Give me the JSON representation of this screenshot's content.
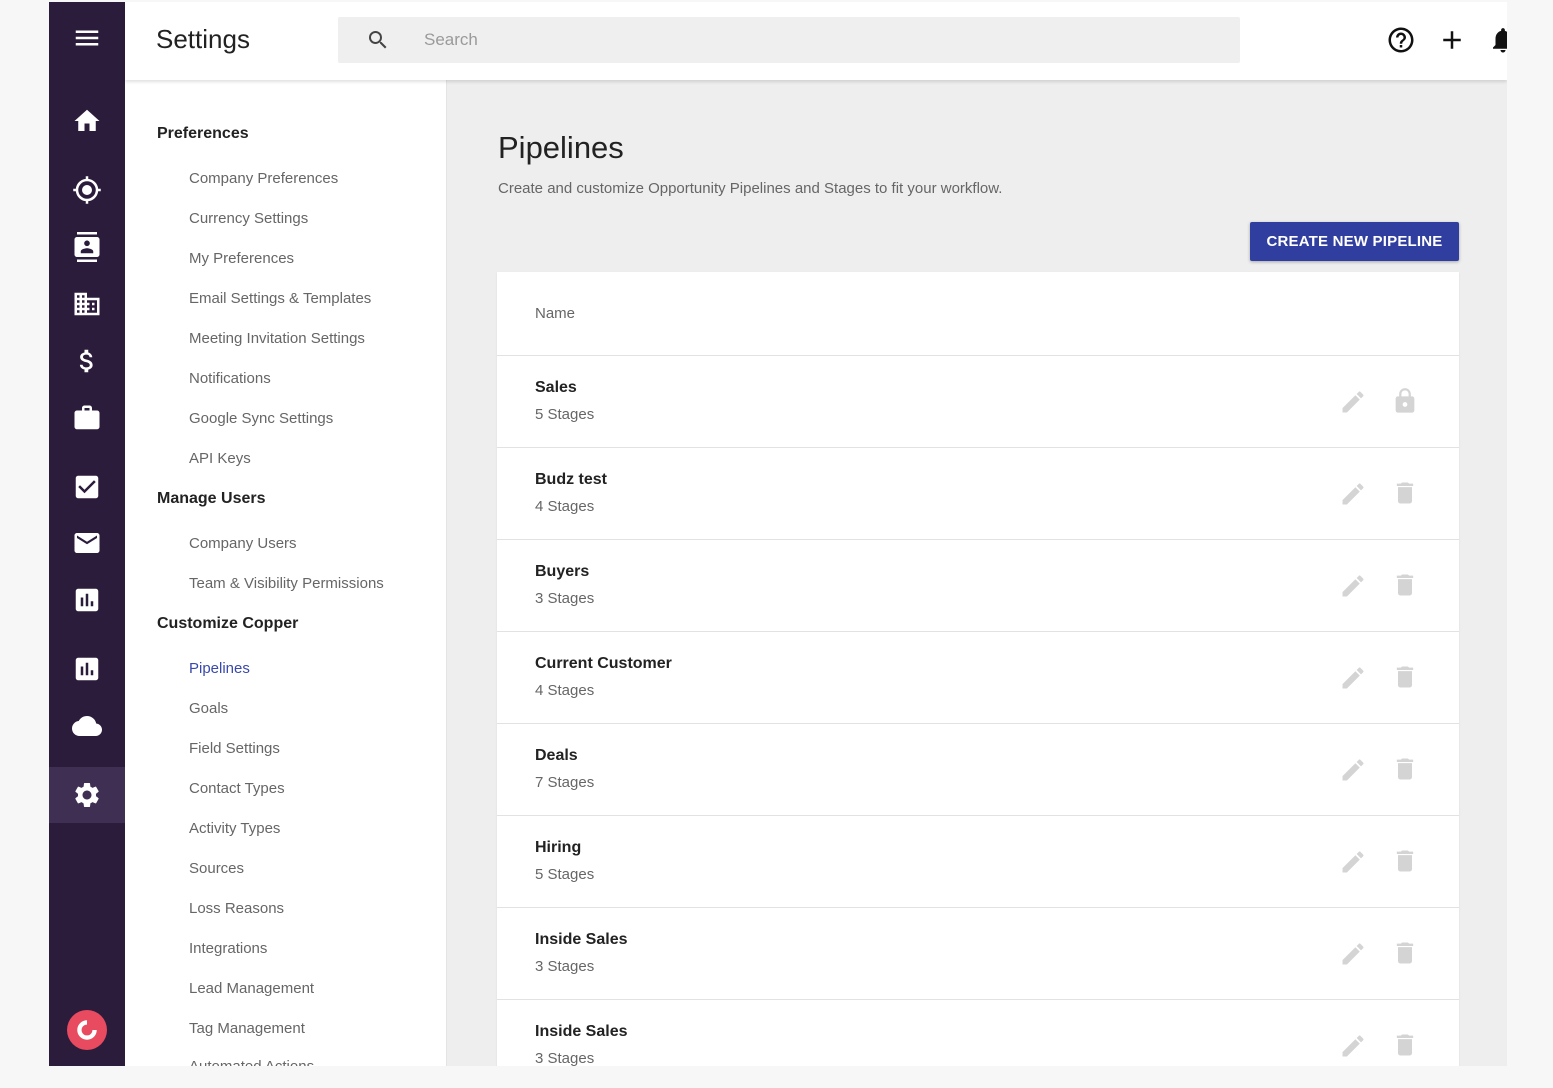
{
  "rail": {
    "items": [
      {
        "icon": "home-icon"
      },
      {
        "icon": "target-icon"
      },
      {
        "icon": "contacts-icon"
      },
      {
        "icon": "building-icon"
      },
      {
        "icon": "dollar-icon"
      },
      {
        "icon": "briefcase-icon"
      },
      {
        "icon": "checkbox-icon"
      },
      {
        "icon": "mail-icon"
      },
      {
        "icon": "report-icon"
      },
      {
        "icon": "dashboard-icon"
      },
      {
        "icon": "cloud-icon"
      },
      {
        "icon": "gear-icon",
        "active": true
      }
    ],
    "logo_icon": "copper-logo-icon",
    "accent": "#2c1c3c",
    "logo_color": "#e84a5f"
  },
  "header": {
    "title": "Settings",
    "search_placeholder": "Search",
    "icons": [
      "help-icon",
      "plus-icon",
      "bell-icon"
    ]
  },
  "nav": {
    "sections": [
      {
        "heading": "Preferences",
        "items": [
          "Company Preferences",
          "Currency Settings",
          "My Preferences",
          "Email Settings & Templates",
          "Meeting Invitation Settings",
          "Notifications",
          "Google Sync Settings",
          "API Keys"
        ]
      },
      {
        "heading": "Manage Users",
        "items": [
          "Company Users",
          "Team & Visibility Permissions"
        ]
      },
      {
        "heading": "Customize Copper",
        "items": [
          "Pipelines",
          "Goals",
          "Field Settings",
          "Contact Types",
          "Activity Types",
          "Sources",
          "Loss Reasons",
          "Integrations",
          "Lead Management",
          "Tag Management",
          "Automated Actions"
        ]
      }
    ],
    "active_item": "Pipelines",
    "active_color": "#3949ab"
  },
  "main": {
    "title": "Pipelines",
    "subtitle": "Create and customize Opportunity Pipelines and Stages to fit your workflow.",
    "create_button": "CREATE NEW PIPELINE",
    "button_color": "#303f9f",
    "table_header": "Name",
    "rows": [
      {
        "name": "Sales",
        "stages": "5 Stages",
        "action_icon": "lock-icon"
      },
      {
        "name": "Budz test",
        "stages": "4 Stages",
        "action_icon": "trash-icon"
      },
      {
        "name": "Buyers",
        "stages": "3 Stages",
        "action_icon": "trash-icon"
      },
      {
        "name": "Current Customer",
        "stages": "4 Stages",
        "action_icon": "trash-icon"
      },
      {
        "name": "Deals",
        "stages": "7 Stages",
        "action_icon": "trash-icon"
      },
      {
        "name": "Hiring",
        "stages": "5 Stages",
        "action_icon": "trash-icon"
      },
      {
        "name": "Inside Sales",
        "stages": "3 Stages",
        "action_icon": "trash-icon"
      },
      {
        "name": "Inside Sales",
        "stages": "3 Stages",
        "action_icon": "trash-icon"
      }
    ]
  }
}
